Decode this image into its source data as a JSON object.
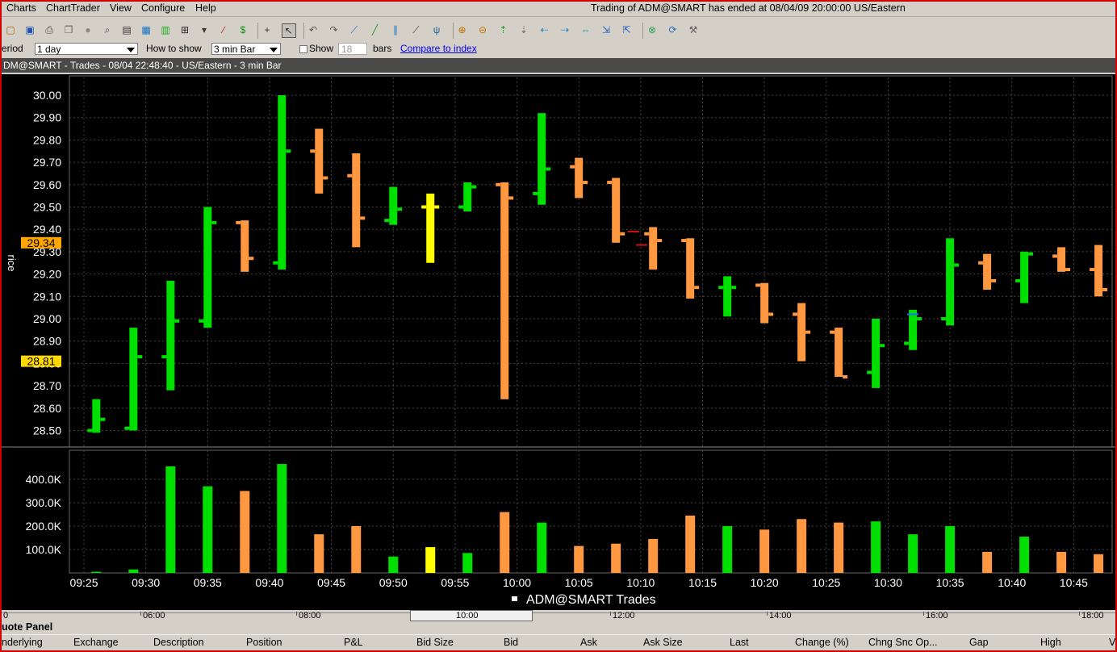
{
  "menu": {
    "items": [
      "Charts",
      "ChartTrader",
      "View",
      "Configure",
      "Help"
    ],
    "status": "Trading of ADM@SMART has ended at 08/04/09 20:00:00 US/Eastern"
  },
  "toolbar": {
    "icons": [
      "folder-icon",
      "save-icon",
      "print-icon",
      "copy-icon",
      "settings-icon",
      "zoom-icon",
      "properties-icon",
      "layout-icon",
      "indicator-icon",
      "grid-icon",
      "bar-type-icon",
      "line-icon",
      "dollar-icon",
      "crosshair-icon",
      "cursor-icon",
      "undo-icon",
      "redo-icon",
      "trendline-icon",
      "fib-icon",
      "channel-icon",
      "gann-icon",
      "pitchfork-icon",
      "zoom-in-icon",
      "zoom-out-icon",
      "scroll-up-icon",
      "scroll-down-icon",
      "scroll-left-icon",
      "scroll-right-icon",
      "fit-icon",
      "expand-icon",
      "contract-icon",
      "link-icon",
      "refresh-icon",
      "wrench-icon"
    ]
  },
  "options": {
    "period_label": "eriod",
    "period_value": "1 day",
    "how_label": "How to show",
    "how_value": "3 min Bar",
    "show_label": "Show",
    "show_value": "18",
    "bars_label": "bars",
    "compare_link": "Compare to index"
  },
  "chart_header": {
    "title": "DM@SMART - Trades - 08/04 22:48:40  - US/Eastern - 3 min Bar"
  },
  "chart_data": {
    "type": "bar",
    "ylabel": "rice",
    "price_ticks": [
      "30.00",
      "29.90",
      "29.80",
      "29.70",
      "29.60",
      "29.50",
      "29.40",
      "29.30",
      "29.20",
      "29.10",
      "29.00",
      "28.90",
      "28.80",
      "28.70",
      "28.60",
      "28.50"
    ],
    "price_markers": [
      {
        "label": "29.34",
        "value": 29.34,
        "color": "#ffa500"
      },
      {
        "label": "28.81",
        "value": 28.81,
        "color": "#ffd800"
      }
    ],
    "ylim_price": [
      28.45,
      30.05
    ],
    "volume_ticks": [
      "400.0K",
      "300.0K",
      "200.0K",
      "100.0K"
    ],
    "ylim_volume": [
      0,
      510000
    ],
    "x_labels": [
      "09:25",
      "09:30",
      "09:35",
      "09:40",
      "09:45",
      "09:50",
      "09:55",
      "10:00",
      "10:05",
      "10:10",
      "10:15",
      "10:20",
      "10:25",
      "10:30",
      "10:35",
      "10:40",
      "10:45"
    ],
    "bars": [
      {
        "time": "09:26",
        "high": 28.64,
        "low": 28.49,
        "open": 28.5,
        "close": 28.55,
        "vol": 5000,
        "color": "#00e000"
      },
      {
        "time": "09:29",
        "high": 28.96,
        "low": 28.5,
        "open": 28.51,
        "close": 28.83,
        "vol": 15000,
        "color": "#00e000"
      },
      {
        "time": "09:32",
        "high": 29.17,
        "low": 28.68,
        "open": 28.83,
        "close": 28.99,
        "vol": 455000,
        "color": "#00e000"
      },
      {
        "time": "09:35",
        "high": 29.5,
        "low": 28.96,
        "open": 28.99,
        "close": 29.43,
        "vol": 370000,
        "color": "#00e000"
      },
      {
        "time": "09:38",
        "high": 29.44,
        "low": 29.21,
        "open": 29.43,
        "close": 29.27,
        "vol": 350000,
        "color": "#ff9840"
      },
      {
        "time": "09:41",
        "high": 30.0,
        "low": 29.22,
        "open": 29.25,
        "close": 29.75,
        "vol": 465000,
        "color": "#00e000"
      },
      {
        "time": "09:44",
        "high": 29.85,
        "low": 29.56,
        "open": 29.75,
        "close": 29.63,
        "vol": 165000,
        "color": "#ff9840"
      },
      {
        "time": "09:47",
        "high": 29.74,
        "low": 29.32,
        "open": 29.64,
        "close": 29.45,
        "vol": 200000,
        "color": "#ff9840"
      },
      {
        "time": "09:50",
        "high": 29.59,
        "low": 29.42,
        "open": 29.44,
        "close": 29.49,
        "vol": 70000,
        "color": "#00e000"
      },
      {
        "time": "09:53",
        "high": 29.56,
        "low": 29.25,
        "open": 29.5,
        "close": 29.5,
        "vol": 110000,
        "color": "#ffff00"
      },
      {
        "time": "09:56",
        "high": 29.61,
        "low": 29.48,
        "open": 29.5,
        "close": 29.59,
        "vol": 85000,
        "color": "#00e000"
      },
      {
        "time": "09:59",
        "high": 29.61,
        "low": 28.64,
        "open": 29.6,
        "close": 29.54,
        "vol": 260000,
        "color": "#ff9840"
      },
      {
        "time": "10:02",
        "high": 29.92,
        "low": 29.51,
        "open": 29.56,
        "close": 29.67,
        "vol": 215000,
        "color": "#00e000"
      },
      {
        "time": "10:05",
        "high": 29.72,
        "low": 29.54,
        "open": 29.68,
        "close": 29.61,
        "vol": 115000,
        "color": "#ff9840"
      },
      {
        "time": "10:08",
        "high": 29.63,
        "low": 29.34,
        "open": 29.61,
        "close": 29.38,
        "vol": 125000,
        "color": "#ff9840"
      },
      {
        "time": "10:11",
        "high": 29.41,
        "low": 29.22,
        "open": 29.38,
        "close": 29.35,
        "vol": 145000,
        "color": "#ff9840"
      },
      {
        "time": "10:14",
        "high": 29.36,
        "low": 29.09,
        "open": 29.35,
        "close": 29.14,
        "vol": 245000,
        "color": "#ff9840"
      },
      {
        "time": "10:17",
        "high": 29.19,
        "low": 29.01,
        "open": 29.14,
        "close": 29.14,
        "vol": 200000,
        "color": "#00e000"
      },
      {
        "time": "10:20",
        "high": 29.16,
        "low": 28.98,
        "open": 29.15,
        "close": 29.02,
        "vol": 185000,
        "color": "#ff9840"
      },
      {
        "time": "10:23",
        "high": 29.07,
        "low": 28.81,
        "open": 29.02,
        "close": 28.94,
        "vol": 230000,
        "color": "#ff9840"
      },
      {
        "time": "10:26",
        "high": 28.96,
        "low": 28.74,
        "open": 28.94,
        "close": 28.74,
        "vol": 215000,
        "color": "#ff9840"
      },
      {
        "time": "10:29",
        "high": 29.0,
        "low": 28.69,
        "open": 28.76,
        "close": 28.88,
        "vol": 220000,
        "color": "#00e000"
      },
      {
        "time": "10:32",
        "high": 29.04,
        "low": 28.86,
        "open": 28.89,
        "close": 29.0,
        "vol": 165000,
        "color": "#00e000"
      },
      {
        "time": "10:35",
        "high": 29.36,
        "low": 28.97,
        "open": 29.0,
        "close": 29.24,
        "vol": 200000,
        "color": "#00e000"
      },
      {
        "time": "10:38",
        "high": 29.29,
        "low": 29.13,
        "open": 29.25,
        "close": 29.17,
        "vol": 90000,
        "color": "#ff9840"
      },
      {
        "time": "10:41",
        "high": 29.3,
        "low": 29.07,
        "open": 29.17,
        "close": 29.29,
        "vol": 155000,
        "color": "#00e000"
      },
      {
        "time": "10:44",
        "high": 29.32,
        "low": 29.21,
        "open": 29.28,
        "close": 29.22,
        "vol": 90000,
        "color": "#ff9840"
      },
      {
        "time": "10:47",
        "high": 29.33,
        "low": 29.1,
        "open": 29.22,
        "close": 29.13,
        "vol": 80000,
        "color": "#ff9840"
      }
    ],
    "legend": "ADM@SMART Trades"
  },
  "navigator": {
    "labels": [
      "0",
      "06:00",
      "08:00",
      "10:00",
      "12:00",
      "14:00",
      "16:00",
      "18:00"
    ]
  },
  "quote_panel": {
    "title": "uote Panel",
    "columns": [
      "nderlying",
      "Exchange",
      "Description",
      "Position",
      "P&L",
      "Bid Size",
      "Bid",
      "Ask",
      "Ask Size",
      "Last",
      "Change (%)",
      "Chng Snc Op...",
      "Gap",
      "High",
      "V"
    ]
  }
}
